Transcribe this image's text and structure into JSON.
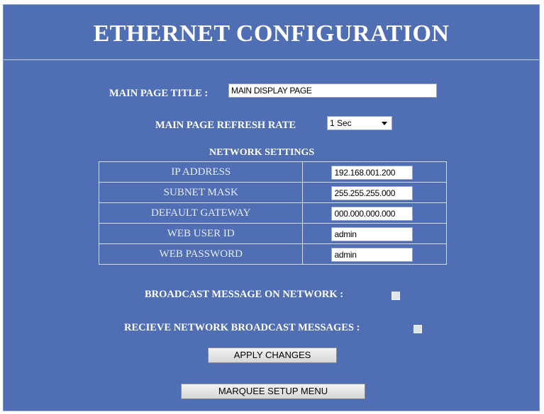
{
  "page": {
    "title": "ETHERNET CONFIGURATION"
  },
  "main_page_title": {
    "label": "MAIN PAGE TITLE :",
    "value": "MAIN DISPLAY PAGE"
  },
  "refresh_rate": {
    "label": "MAIN PAGE REFRESH RATE",
    "selected": "1 Sec"
  },
  "network_settings": {
    "heading": "NETWORK SETTINGS",
    "rows": [
      {
        "label": "IP ADDRESS",
        "value": "192.168.001.200"
      },
      {
        "label": "SUBNET MASK",
        "value": "255.255.255.000"
      },
      {
        "label": "DEFAULT GATEWAY",
        "value": "000.000.000.000"
      },
      {
        "label": "WEB USER ID",
        "value": "admin"
      },
      {
        "label": "WEB PASSWORD",
        "value": "admin"
      }
    ]
  },
  "broadcast": {
    "send_label": "BROADCAST MESSAGE ON NETWORK :",
    "receive_label": "RECIEVE NETWORK BROADCAST MESSAGES :"
  },
  "buttons": {
    "apply": "APPLY CHANGES",
    "marquee": "MARQUEE SETUP MENU"
  },
  "colors": {
    "panel_background": "#4f6eb3",
    "text": "#ffffff"
  }
}
